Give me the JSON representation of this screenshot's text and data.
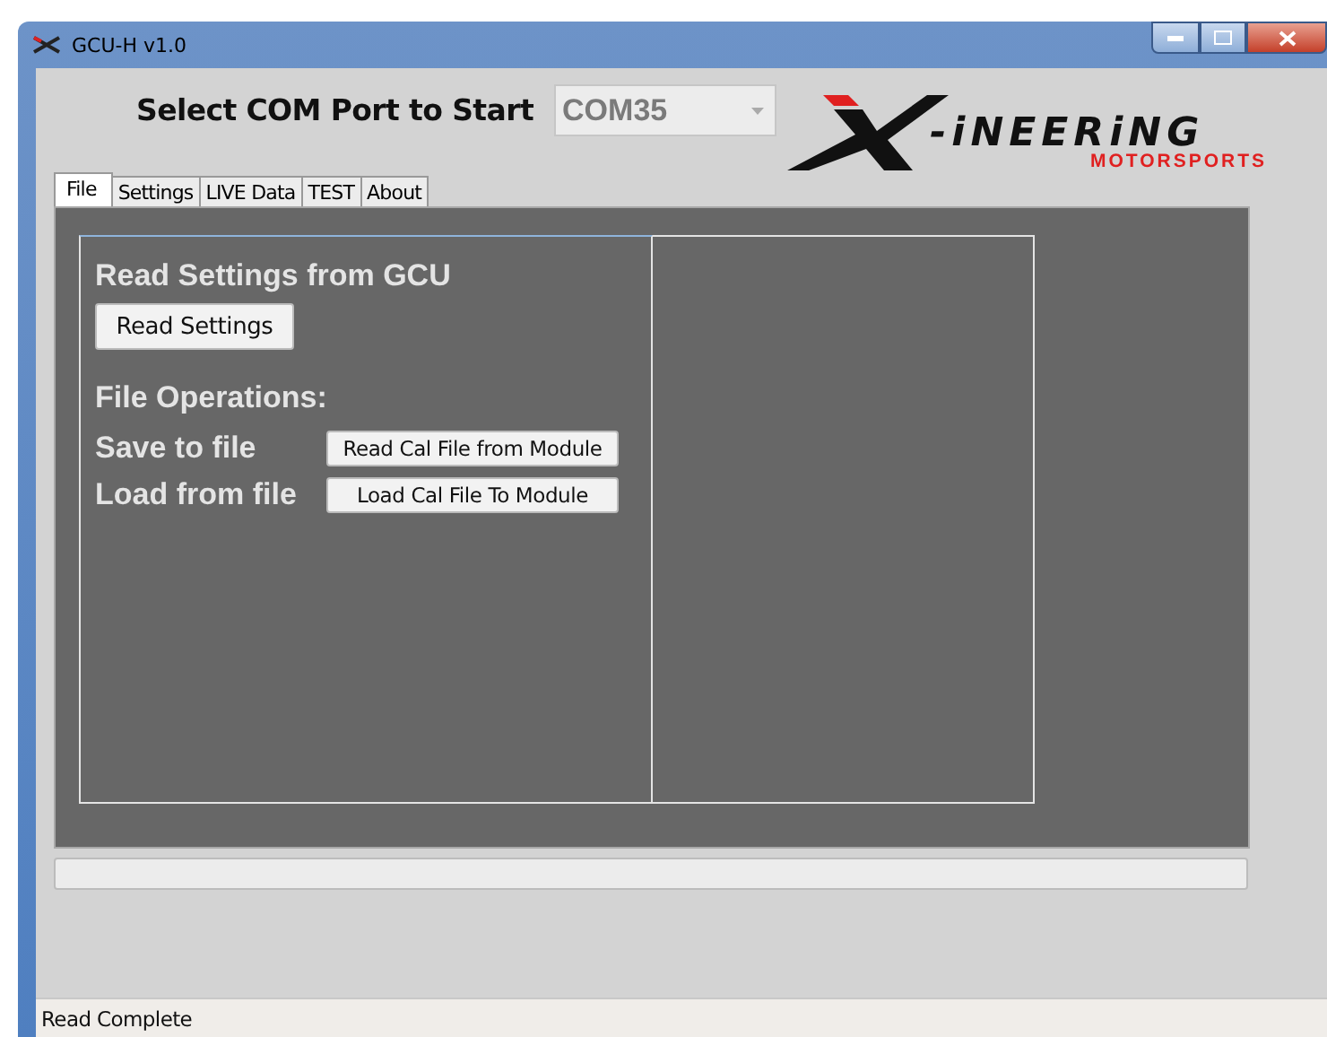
{
  "window": {
    "title": "GCU-H v1.0"
  },
  "header": {
    "label": "Select COM Port to Start",
    "com_port": {
      "value": "COM35",
      "disabled": true
    }
  },
  "logo": {
    "wordmark": "-iNEERiNG",
    "tagline": "MOTORSPORTS"
  },
  "tabs": [
    {
      "label": "File",
      "selected": true
    },
    {
      "label": "Settings",
      "selected": false
    },
    {
      "label": "LIVE Data",
      "selected": false
    },
    {
      "label": "TEST",
      "selected": false
    },
    {
      "label": "About",
      "selected": false
    }
  ],
  "file_panel": {
    "read_heading": "Read Settings from GCU",
    "read_button": "Read Settings",
    "ops_heading": "File Operations:",
    "rows": [
      {
        "label": "Save to file",
        "button": "Read Cal File from Module"
      },
      {
        "label": "Load from file",
        "button": "Load Cal File To Module"
      }
    ]
  },
  "progress": {
    "level": 0
  },
  "status_bar": {
    "text": "Read Complete"
  }
}
